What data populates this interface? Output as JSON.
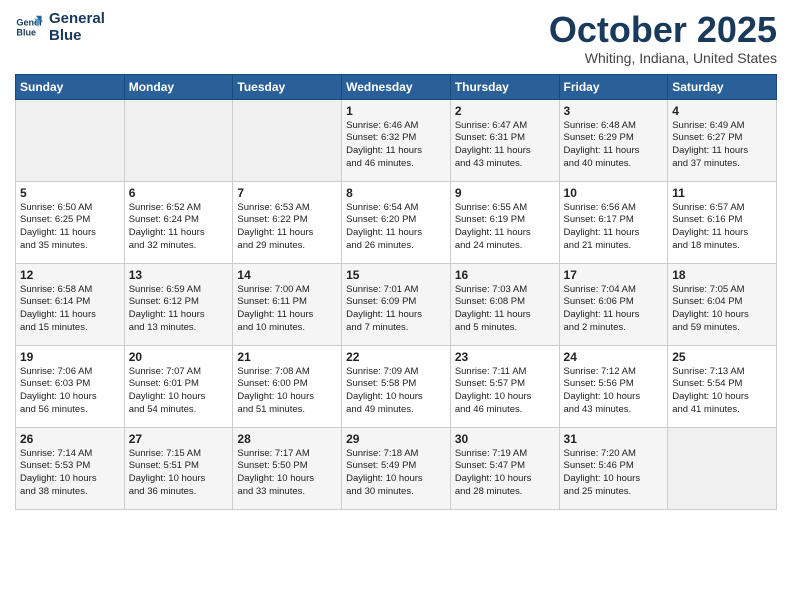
{
  "header": {
    "logo_line1": "General",
    "logo_line2": "Blue",
    "month": "October 2025",
    "location": "Whiting, Indiana, United States"
  },
  "weekdays": [
    "Sunday",
    "Monday",
    "Tuesday",
    "Wednesday",
    "Thursday",
    "Friday",
    "Saturday"
  ],
  "weeks": [
    [
      {
        "day": "",
        "info": ""
      },
      {
        "day": "",
        "info": ""
      },
      {
        "day": "",
        "info": ""
      },
      {
        "day": "1",
        "info": "Sunrise: 6:46 AM\nSunset: 6:32 PM\nDaylight: 11 hours\nand 46 minutes."
      },
      {
        "day": "2",
        "info": "Sunrise: 6:47 AM\nSunset: 6:31 PM\nDaylight: 11 hours\nand 43 minutes."
      },
      {
        "day": "3",
        "info": "Sunrise: 6:48 AM\nSunset: 6:29 PM\nDaylight: 11 hours\nand 40 minutes."
      },
      {
        "day": "4",
        "info": "Sunrise: 6:49 AM\nSunset: 6:27 PM\nDaylight: 11 hours\nand 37 minutes."
      }
    ],
    [
      {
        "day": "5",
        "info": "Sunrise: 6:50 AM\nSunset: 6:25 PM\nDaylight: 11 hours\nand 35 minutes."
      },
      {
        "day": "6",
        "info": "Sunrise: 6:52 AM\nSunset: 6:24 PM\nDaylight: 11 hours\nand 32 minutes."
      },
      {
        "day": "7",
        "info": "Sunrise: 6:53 AM\nSunset: 6:22 PM\nDaylight: 11 hours\nand 29 minutes."
      },
      {
        "day": "8",
        "info": "Sunrise: 6:54 AM\nSunset: 6:20 PM\nDaylight: 11 hours\nand 26 minutes."
      },
      {
        "day": "9",
        "info": "Sunrise: 6:55 AM\nSunset: 6:19 PM\nDaylight: 11 hours\nand 24 minutes."
      },
      {
        "day": "10",
        "info": "Sunrise: 6:56 AM\nSunset: 6:17 PM\nDaylight: 11 hours\nand 21 minutes."
      },
      {
        "day": "11",
        "info": "Sunrise: 6:57 AM\nSunset: 6:16 PM\nDaylight: 11 hours\nand 18 minutes."
      }
    ],
    [
      {
        "day": "12",
        "info": "Sunrise: 6:58 AM\nSunset: 6:14 PM\nDaylight: 11 hours\nand 15 minutes."
      },
      {
        "day": "13",
        "info": "Sunrise: 6:59 AM\nSunset: 6:12 PM\nDaylight: 11 hours\nand 13 minutes."
      },
      {
        "day": "14",
        "info": "Sunrise: 7:00 AM\nSunset: 6:11 PM\nDaylight: 11 hours\nand 10 minutes."
      },
      {
        "day": "15",
        "info": "Sunrise: 7:01 AM\nSunset: 6:09 PM\nDaylight: 11 hours\nand 7 minutes."
      },
      {
        "day": "16",
        "info": "Sunrise: 7:03 AM\nSunset: 6:08 PM\nDaylight: 11 hours\nand 5 minutes."
      },
      {
        "day": "17",
        "info": "Sunrise: 7:04 AM\nSunset: 6:06 PM\nDaylight: 11 hours\nand 2 minutes."
      },
      {
        "day": "18",
        "info": "Sunrise: 7:05 AM\nSunset: 6:04 PM\nDaylight: 10 hours\nand 59 minutes."
      }
    ],
    [
      {
        "day": "19",
        "info": "Sunrise: 7:06 AM\nSunset: 6:03 PM\nDaylight: 10 hours\nand 56 minutes."
      },
      {
        "day": "20",
        "info": "Sunrise: 7:07 AM\nSunset: 6:01 PM\nDaylight: 10 hours\nand 54 minutes."
      },
      {
        "day": "21",
        "info": "Sunrise: 7:08 AM\nSunset: 6:00 PM\nDaylight: 10 hours\nand 51 minutes."
      },
      {
        "day": "22",
        "info": "Sunrise: 7:09 AM\nSunset: 5:58 PM\nDaylight: 10 hours\nand 49 minutes."
      },
      {
        "day": "23",
        "info": "Sunrise: 7:11 AM\nSunset: 5:57 PM\nDaylight: 10 hours\nand 46 minutes."
      },
      {
        "day": "24",
        "info": "Sunrise: 7:12 AM\nSunset: 5:56 PM\nDaylight: 10 hours\nand 43 minutes."
      },
      {
        "day": "25",
        "info": "Sunrise: 7:13 AM\nSunset: 5:54 PM\nDaylight: 10 hours\nand 41 minutes."
      }
    ],
    [
      {
        "day": "26",
        "info": "Sunrise: 7:14 AM\nSunset: 5:53 PM\nDaylight: 10 hours\nand 38 minutes."
      },
      {
        "day": "27",
        "info": "Sunrise: 7:15 AM\nSunset: 5:51 PM\nDaylight: 10 hours\nand 36 minutes."
      },
      {
        "day": "28",
        "info": "Sunrise: 7:17 AM\nSunset: 5:50 PM\nDaylight: 10 hours\nand 33 minutes."
      },
      {
        "day": "29",
        "info": "Sunrise: 7:18 AM\nSunset: 5:49 PM\nDaylight: 10 hours\nand 30 minutes."
      },
      {
        "day": "30",
        "info": "Sunrise: 7:19 AM\nSunset: 5:47 PM\nDaylight: 10 hours\nand 28 minutes."
      },
      {
        "day": "31",
        "info": "Sunrise: 7:20 AM\nSunset: 5:46 PM\nDaylight: 10 hours\nand 25 minutes."
      },
      {
        "day": "",
        "info": ""
      }
    ]
  ]
}
